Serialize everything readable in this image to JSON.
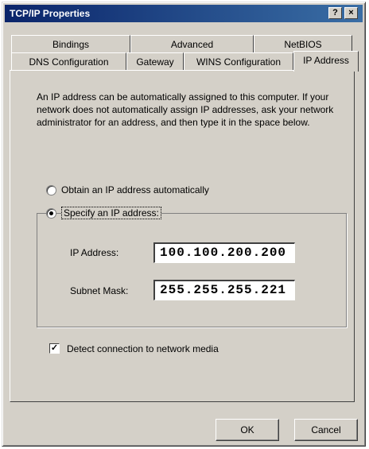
{
  "window": {
    "title": "TCP/IP Properties",
    "help_glyph": "?",
    "close_glyph": "×"
  },
  "tabs": {
    "row1": [
      "Bindings",
      "Advanced",
      "NetBIOS"
    ],
    "row2": [
      "DNS Configuration",
      "Gateway",
      "WINS Configuration",
      "IP Address"
    ],
    "active": "IP Address"
  },
  "panel": {
    "description": "An IP address can be automatically assigned to this computer. If your network does not automatically assign IP addresses, ask your network administrator for an address, and then type it in the space below.",
    "radio_auto_label": "Obtain an IP address automatically",
    "radio_specify_label": "Specify an IP address:",
    "selected_option": "Specify an IP address:",
    "ip_label": "IP Address:",
    "ip_value": "100.100.200.200",
    "subnet_label": "Subnet Mask:",
    "subnet_value": "255.255.255.221",
    "detect_label": "Detect connection to network media",
    "detect_checked": true,
    "detect_mark": "✓"
  },
  "buttons": {
    "ok": "OK",
    "cancel": "Cancel"
  },
  "colors": {
    "face": "#d4d0c8",
    "title_start": "#0a246a",
    "title_end": "#3a6ea5"
  }
}
